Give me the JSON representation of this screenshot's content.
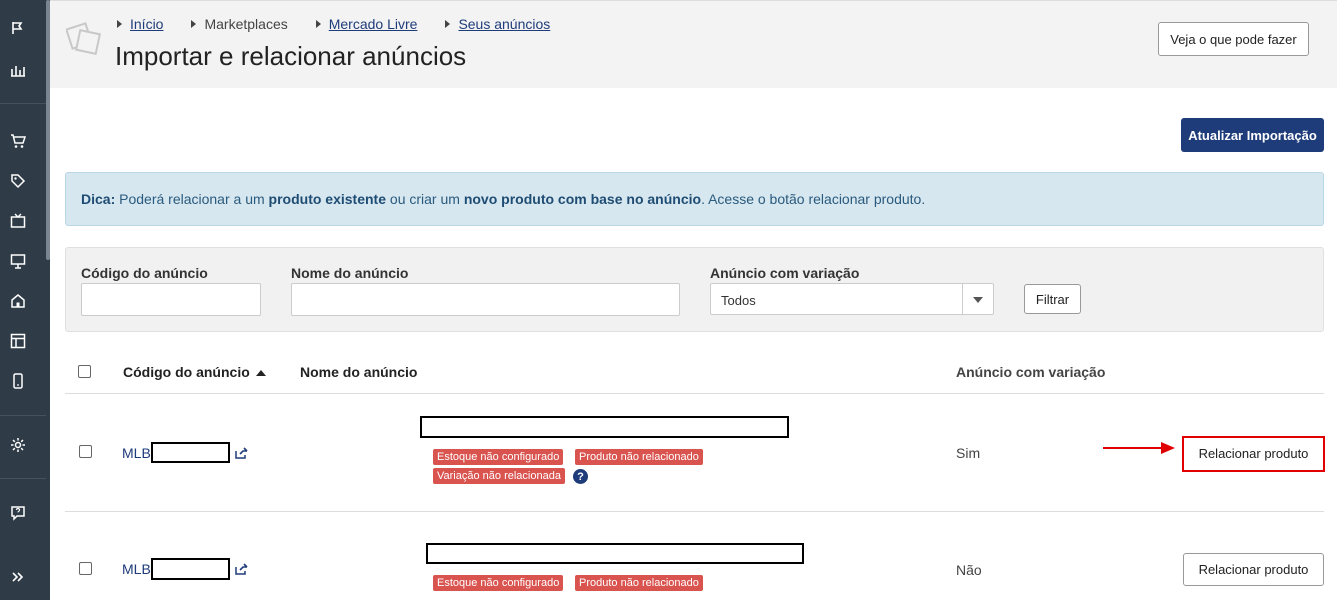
{
  "breadcrumb": [
    {
      "label": "Início",
      "link": true
    },
    {
      "label": "Marketplaces",
      "link": false
    },
    {
      "label": "Mercado Livre",
      "link": true
    },
    {
      "label": "Seus anúncios",
      "link": true
    }
  ],
  "page_title": "Importar e relacionar anúncios",
  "header_button": "Veja o que pode fazer",
  "update_button": "Atualizar Importação",
  "tip": {
    "prefix": "Dica:",
    "t1": " Poderá relacionar a um ",
    "b1": "produto existente",
    "t2": " ou criar um ",
    "b2": "novo produto com base no anúncio",
    "t3": ". Acesse o botão relacionar produto."
  },
  "filters": {
    "codigo_label": "Código do anúncio",
    "nome_label": "Nome do anúncio",
    "variacao_label": "Anúncio com variação",
    "variacao_value": "Todos",
    "filter_button": "Filtrar"
  },
  "table": {
    "col_codigo": "Código do anúncio",
    "col_nome": "Nome do anúncio",
    "col_variacao": "Anúncio com variação",
    "rows": [
      {
        "code_prefix": "MLB",
        "tags": [
          "Estoque não configurado",
          "Produto não relacionado",
          "Variação não relacionada"
        ],
        "help": "?",
        "variacao": "Sim",
        "action": "Relacionar produto"
      },
      {
        "code_prefix": "MLB",
        "tags": [
          "Estoque não configurado",
          "Produto não relacionado"
        ],
        "variacao": "Não",
        "action": "Relacionar produto"
      }
    ]
  },
  "colors": {
    "primary": "#1f3c7a",
    "sidebar": "#2f3b47",
    "tag": "#d9534f",
    "highlight": "#e00000",
    "tip_bg": "#d6e7f0"
  },
  "icons": {
    "sidebar": [
      "flag-icon",
      "bar-chart-icon",
      "cart-icon",
      "tag-icon",
      "tv-icon",
      "monitor-icon",
      "home-icon",
      "layout-icon",
      "mobile-icon",
      "gear-icon",
      "help-chat-icon",
      "double-chevron-right-icon"
    ]
  }
}
